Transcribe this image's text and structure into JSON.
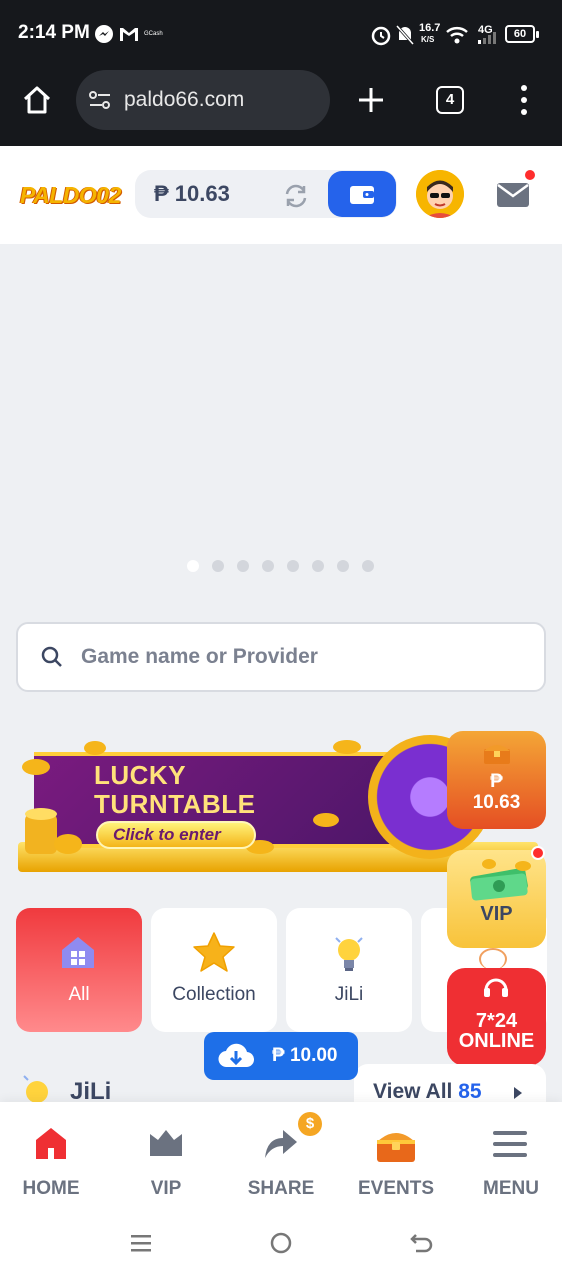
{
  "status_bar": {
    "time": "2:14 PM",
    "notification_icons": [
      "messenger-icon",
      "gmail-icon",
      "gcash-icon"
    ],
    "gcash_label": "GCash",
    "net_speed_value": "16.7",
    "net_speed_unit": "K/S",
    "network": "4G",
    "battery": "60"
  },
  "browser": {
    "url": "paldo66.com",
    "tab_count": "4"
  },
  "header": {
    "logo_text": "PALDO02",
    "balance": "₱ 10.63",
    "has_unread_mail": true
  },
  "banner": {
    "slide_count": 8,
    "active_slide": 0
  },
  "search": {
    "placeholder": "Game name or Provider"
  },
  "promo": {
    "title_line1": "LUCKY",
    "title_line2": "TURNTABLE",
    "cta": "Click to enter"
  },
  "categories": [
    {
      "label": "All",
      "icon": "home-grid-icon",
      "active": true
    },
    {
      "label": "Collection",
      "icon": "star-icon",
      "active": false
    },
    {
      "label": "JiLi",
      "icon": "bulb-icon",
      "active": false
    },
    {
      "label": "",
      "icon": "provider-icon",
      "active": false
    }
  ],
  "floating": {
    "balance_amount": "₱\n10.63",
    "vip_label": "VIP",
    "online_label_1": "7*24",
    "online_label_2": "ONLINE"
  },
  "download": {
    "amount": "₱ 10.00"
  },
  "section": {
    "title": "JiLi",
    "view_all_label": "View All",
    "view_all_count": "85"
  },
  "bottom_nav": [
    {
      "label": "HOME",
      "icon": "home-icon"
    },
    {
      "label": "VIP",
      "icon": "crown-icon"
    },
    {
      "label": "SHARE",
      "icon": "share-icon"
    },
    {
      "label": "EVENTS",
      "icon": "treasure-chest-icon"
    },
    {
      "label": "MENU",
      "icon": "menu-icon"
    }
  ],
  "share_badge": "$",
  "colors": {
    "accent_blue": "#2563eb",
    "active_red": "#ef2f33",
    "text_dark": "#3c4762"
  }
}
